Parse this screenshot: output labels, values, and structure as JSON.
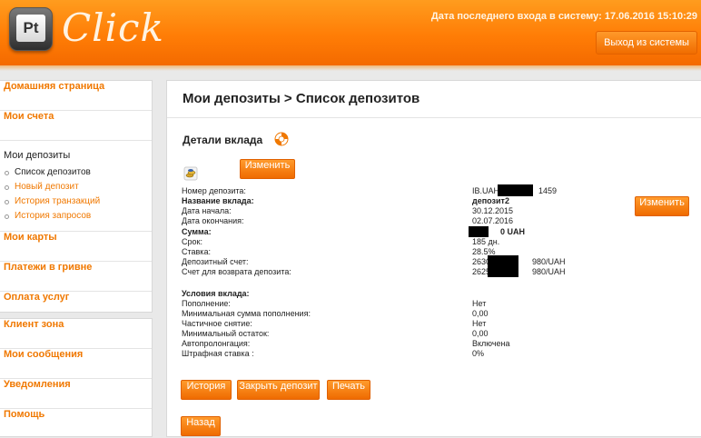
{
  "header": {
    "logo_badge": "Pt",
    "logo_text": "Click",
    "last_login": "Дата последнего входа в систему: 17.06.2016 15:10:29",
    "logout_label": "Выход из системы"
  },
  "sidebar": {
    "items_top": [
      {
        "label": "Домашняя страница"
      },
      {
        "label": "Мои счета"
      }
    ],
    "deposits": {
      "heading": "Мои депозиты",
      "sub": [
        {
          "label": "Список депозитов"
        },
        {
          "label": "Новый депозит"
        },
        {
          "label": "История транзакций"
        },
        {
          "label": "История запросов"
        }
      ]
    },
    "items_mid": [
      {
        "label": "Мои карты"
      },
      {
        "label": "Платежи в гривне"
      },
      {
        "label": "Оплата услуг"
      }
    ],
    "items_bottom": [
      {
        "label": "Клиент зона"
      },
      {
        "label": "Мои сообщения"
      },
      {
        "label": "Уведомления"
      },
      {
        "label": "Помощь"
      }
    ]
  },
  "main": {
    "page_title": "Мои депозиты > Список депозитов",
    "details_title": "Детали вклада",
    "edit_label": "Изменить",
    "rows": [
      {
        "label": "Номер депозита:",
        "value": "IB.UAH",
        "value_tail": "1459"
      },
      {
        "label": "Название вклада:",
        "value": "депозит2"
      },
      {
        "label": "Дата начала:",
        "value": "30.12.2015"
      },
      {
        "label": "Дата окончания:",
        "value": "02.07.2016"
      },
      {
        "label": "Сумма:",
        "value": "0 UAH"
      },
      {
        "label": "Срок:",
        "value": "185 дн."
      },
      {
        "label": "Ставка:",
        "value": "28.5%"
      },
      {
        "label": "Депозитный счет:",
        "value": "2630",
        "value_tail": "980/UAH"
      },
      {
        "label": "Счет для возврата депозита:",
        "value": "2625",
        "value_tail": "980/UAH"
      }
    ],
    "conditions_title": "Условия вклада:",
    "conditions": [
      {
        "label": "Пополнение:",
        "value": "Нет"
      },
      {
        "label": "Минимальная сумма пополнения:",
        "value": "0,00"
      },
      {
        "label": "Частичное снятие:",
        "value": "Нет"
      },
      {
        "label": "Минимальный остаток:",
        "value": "0,00"
      },
      {
        "label": "Автопролонгация:",
        "value": "Включена"
      },
      {
        "label": "Штрафная ставка :",
        "value": "0%"
      }
    ],
    "buttons": {
      "history": "История",
      "close_deposit": "Закрыть депозит",
      "print": "Печать",
      "back": "Назад"
    }
  },
  "colors": {
    "accent": "#f07800",
    "header_top": "#ff9c1e",
    "header_bottom": "#f46a00"
  }
}
